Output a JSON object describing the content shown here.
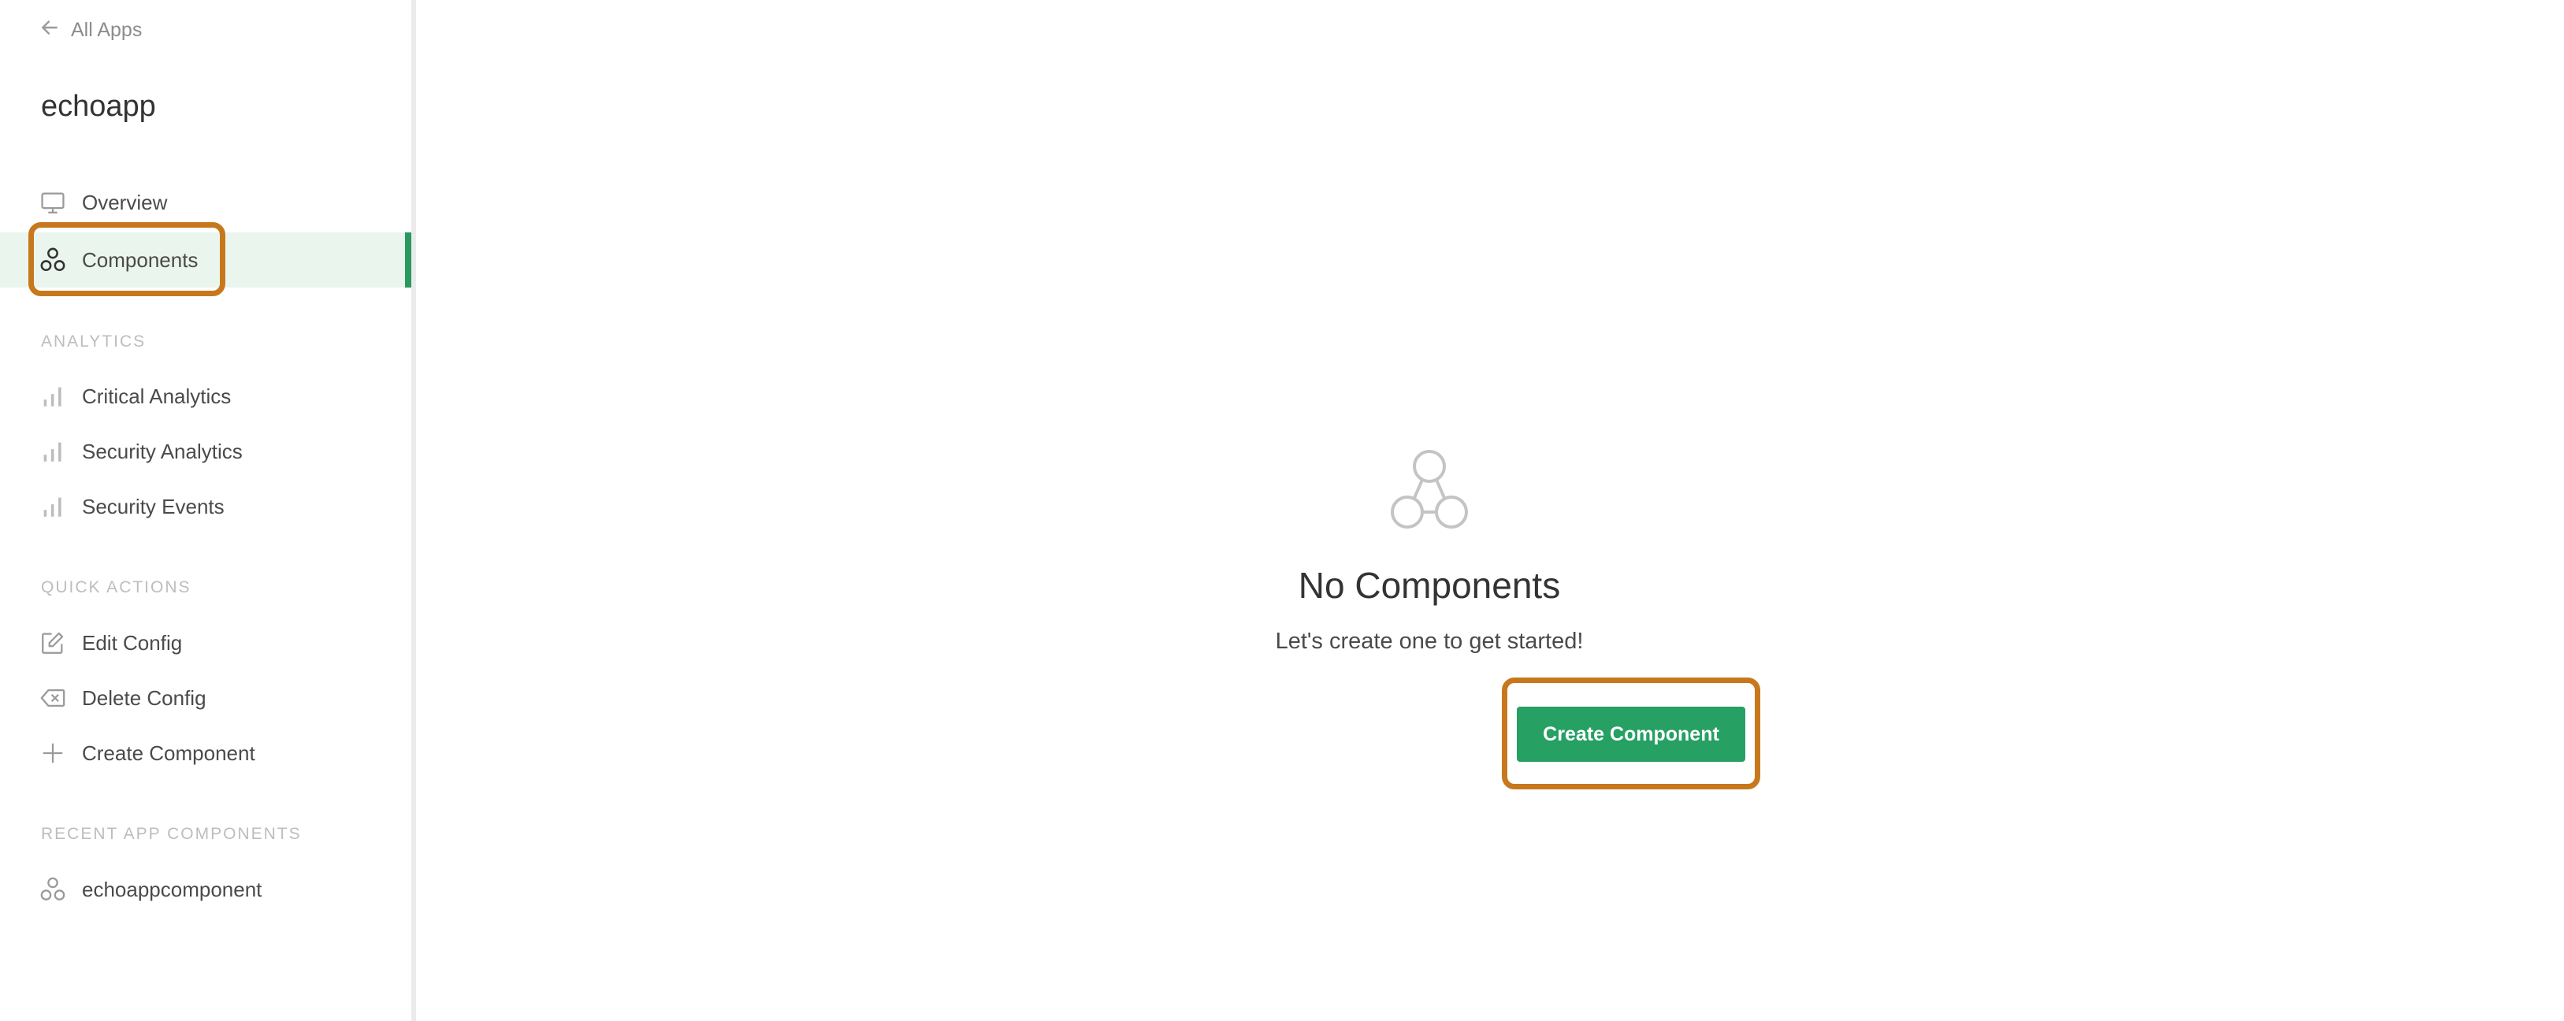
{
  "sidebar": {
    "back_label": "All Apps",
    "app_name": "echoapp",
    "nav": {
      "overview": "Overview",
      "components": "Components"
    },
    "sections": {
      "analytics": "ANALYTICS",
      "quick_actions": "QUICK ACTIONS",
      "recent": "RECENT APP COMPONENTS"
    },
    "analytics": {
      "critical": "Critical Analytics",
      "security": "Security Analytics",
      "events": "Security Events"
    },
    "quick_actions": {
      "edit": "Edit Config",
      "delete": "Delete Config",
      "create": "Create Component"
    },
    "recent": {
      "item1": "echoappcomponent"
    }
  },
  "main": {
    "empty_title": "No Components",
    "empty_subtitle": "Let's create one to get started!",
    "create_button": "Create Component"
  },
  "colors": {
    "accent": "#2a9960",
    "active_bg": "#eaf5ee",
    "highlight": "#c8781c"
  }
}
